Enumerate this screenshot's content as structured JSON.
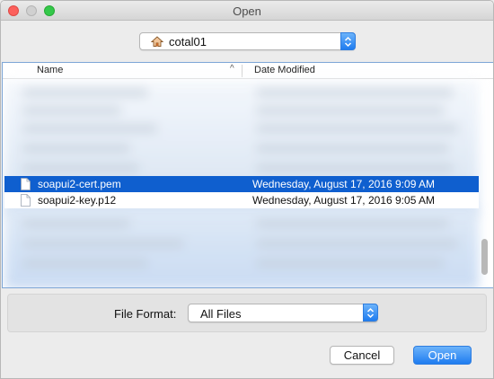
{
  "window": {
    "title": "Open"
  },
  "location": {
    "folder": "cotal01",
    "icon": "home-icon"
  },
  "file_list": {
    "columns": {
      "name": "Name",
      "date": "Date Modified"
    },
    "sort_indicator": "^",
    "rows": [
      {
        "name": "soapui2-cert.pem",
        "date": "Wednesday, August 17, 2016 9:09 AM",
        "selected": true
      },
      {
        "name": "soapui2-key.p12",
        "date": "Wednesday, August 17, 2016 9:05 AM",
        "selected": false
      }
    ]
  },
  "file_format": {
    "label": "File Format:",
    "value": "All Files"
  },
  "buttons": {
    "cancel": "Cancel",
    "open": "Open"
  },
  "colors": {
    "selection": "#0f5fcf",
    "accent": "#1f7cf0"
  }
}
